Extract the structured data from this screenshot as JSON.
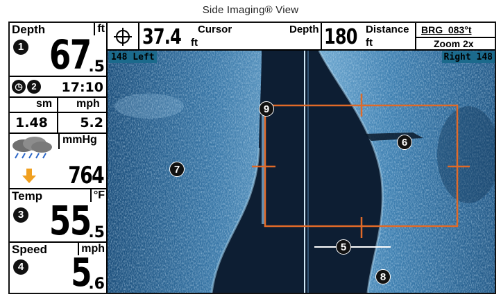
{
  "caption": "Side Imaging® View",
  "depth_panel": {
    "label": "Depth",
    "unit": "ft",
    "value_int": "67",
    "value_dec": ".5",
    "callout": "1"
  },
  "time_panel": {
    "time": "17:10",
    "callout": "2"
  },
  "speed_units": {
    "left_unit": "sm",
    "right_unit": "mph",
    "left_value": "1.48",
    "right_value": "5.2"
  },
  "barometer": {
    "unit": "mmHg",
    "value": "764"
  },
  "temp_panel": {
    "label": "Temp",
    "unit": "°F",
    "value_int": "55",
    "value_dec": ".5",
    "callout": "3"
  },
  "speed_panel": {
    "label": "Speed",
    "unit": "mph",
    "value_int": "5",
    "value_dec": ".6",
    "callout": "4"
  },
  "topbar": {
    "cursor_label": "Cursor",
    "cursor_value": "37.4",
    "cursor_unit": "ft",
    "depth_label": "Depth",
    "depth_value": "180",
    "distance_label": "Distance",
    "distance_unit": "ft",
    "brg_label": "BRG  083°t",
    "zoom_label": "Zoom 2x"
  },
  "sonar": {
    "left_range": "148 Left",
    "right_range": "Right 148",
    "callouts": {
      "five": "5",
      "six": "6",
      "seven": "7",
      "eight": "8",
      "nine": "9"
    }
  },
  "colors": {
    "water": "#0d1e33",
    "bottom": "#3a78a8",
    "zoom_box": "#e06a28"
  }
}
